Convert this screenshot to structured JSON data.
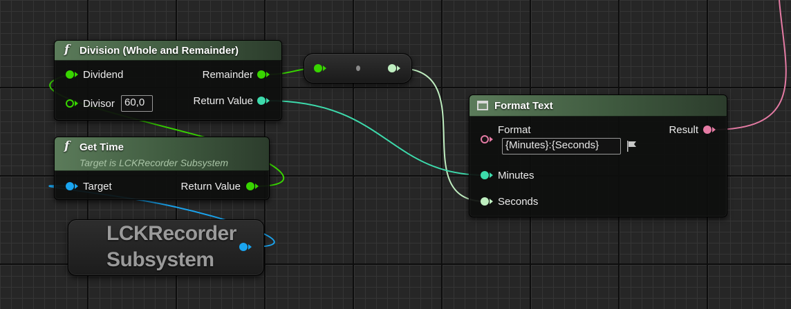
{
  "colors": {
    "int_pin": "#38d500",
    "float_pin": "#3ddbac",
    "object_pin": "#1aa5f0",
    "text_pin": "#e57ba4",
    "light_pin": "#bfeec0",
    "header_green": "#4c6b4b"
  },
  "division_node": {
    "icon": "f",
    "title": "Division (Whole and Remainder)",
    "pins": {
      "dividend": "Dividend",
      "divisor": "Divisor",
      "divisor_value": "60,0",
      "remainder": "Remainder",
      "return_value": "Return Value"
    }
  },
  "get_time_node": {
    "icon": "f",
    "title": "Get Time",
    "subtitle": "Target is LCKRecorder Subsystem",
    "pins": {
      "target": "Target",
      "return_value": "Return Value"
    }
  },
  "subsystem_node": {
    "line1": "LCKRecorder",
    "line2": "Subsystem"
  },
  "format_text_node": {
    "title": "Format Text",
    "icon_name": "window-icon",
    "pins": {
      "format": "Format",
      "format_value": "{Minutes}:{Seconds}",
      "result": "Result",
      "minutes": "Minutes",
      "seconds": "Seconds"
    },
    "flag_icon": "flag-icon"
  },
  "conversion_node": {
    "icon_name": "conversion-dot-icon"
  }
}
